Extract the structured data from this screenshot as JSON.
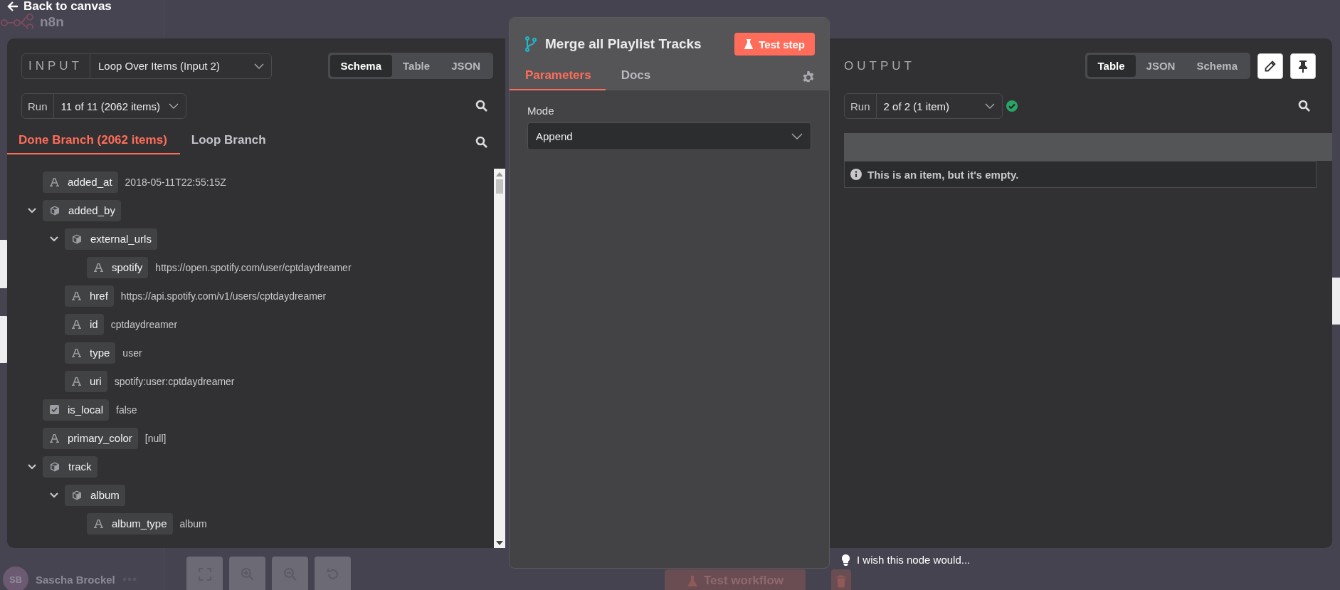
{
  "back_link": "Back to canvas",
  "canvas": {
    "logo_text": "n8n",
    "test_workflow": "Test workflow",
    "user_initials": "SB",
    "user_name": "Sascha Brockel"
  },
  "input": {
    "label": "INPUT",
    "source": "Loop Over Items (Input 2)",
    "views": [
      {
        "label": "Schema",
        "selected": true
      },
      {
        "label": "Table",
        "selected": false
      },
      {
        "label": "JSON",
        "selected": false
      }
    ],
    "run_label": "Run",
    "run": "11 of 11 (2062 items)",
    "branches": [
      {
        "label": "Done Branch (2062 items)",
        "selected": true
      },
      {
        "label": "Loop Branch",
        "selected": false
      }
    ],
    "tree": [
      {
        "kind": "string",
        "key": "added_at",
        "value": "2018-05-11T22:55:15Z"
      },
      {
        "kind": "object",
        "key": "added_by",
        "expanded": true,
        "children": [
          {
            "kind": "object",
            "key": "external_urls",
            "expanded": true,
            "children": [
              {
                "kind": "string",
                "key": "spotify",
                "value": "https://open.spotify.com/user/cptdaydreamer"
              }
            ]
          },
          {
            "kind": "string",
            "key": "href",
            "value": "https://api.spotify.com/v1/users/cptdaydreamer"
          },
          {
            "kind": "string",
            "key": "id",
            "value": "cptdaydreamer"
          },
          {
            "kind": "string",
            "key": "type",
            "value": "user"
          },
          {
            "kind": "string",
            "key": "uri",
            "value": "spotify:user:cptdaydreamer"
          }
        ]
      },
      {
        "kind": "boolean",
        "key": "is_local",
        "value": "false"
      },
      {
        "kind": "string",
        "key": "primary_color",
        "value": "[null]"
      },
      {
        "kind": "object",
        "key": "track",
        "expanded": true,
        "children": [
          {
            "kind": "object",
            "key": "album",
            "expanded": true,
            "children": [
              {
                "kind": "string",
                "key": "album_type",
                "value": "album"
              }
            ]
          }
        ]
      }
    ]
  },
  "node": {
    "title": "Merge all Playlist Tracks",
    "test_button": "Test step",
    "tabs": [
      {
        "label": "Parameters",
        "selected": true
      },
      {
        "label": "Docs",
        "selected": false
      }
    ],
    "mode_label": "Mode",
    "mode_value": "Append"
  },
  "output": {
    "label": "OUTPUT",
    "views": [
      {
        "label": "Table",
        "selected": true
      },
      {
        "label": "JSON",
        "selected": false
      },
      {
        "label": "Schema",
        "selected": false
      }
    ],
    "run_label": "Run",
    "run": "2 of 2 (1 item)",
    "run_success": true,
    "empty_message": "This is an item, but it's empty."
  },
  "feedback": "I wish this node would..."
}
